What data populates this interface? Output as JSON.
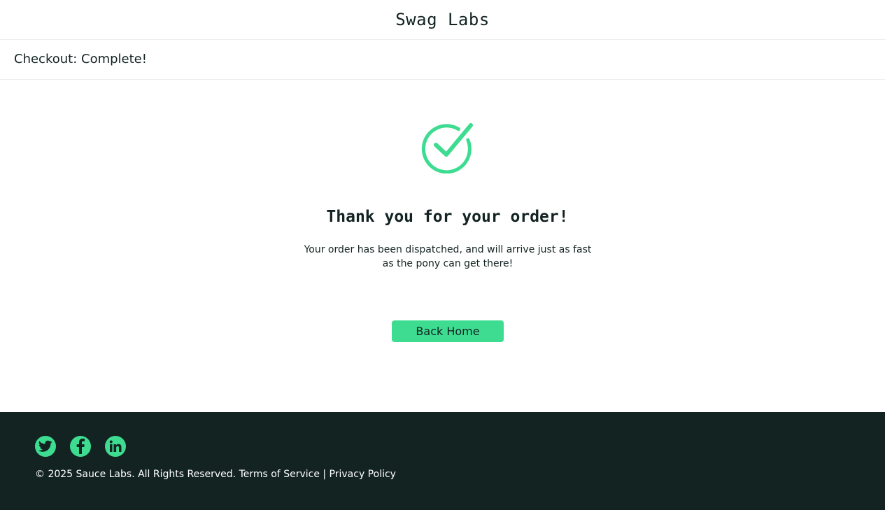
{
  "header": {
    "app_logo": "Swag Labs"
  },
  "subheader": {
    "title": "Checkout: Complete!"
  },
  "main": {
    "icon": "checkmark-circle-icon",
    "complete_header": "Thank you for your order!",
    "complete_text": "Your order has been dispatched, and will arrive just as fast as the pony can get there!",
    "back_home_label": "Back Home"
  },
  "footer": {
    "social": [
      "twitter-icon",
      "facebook-icon",
      "linkedin-icon"
    ],
    "copy": "© 2025 Sauce Labs. All Rights Reserved. Terms of Service | Privacy Policy"
  },
  "colors": {
    "accent": "#3ddc91",
    "dark": "#132322",
    "border": "#ededef"
  }
}
